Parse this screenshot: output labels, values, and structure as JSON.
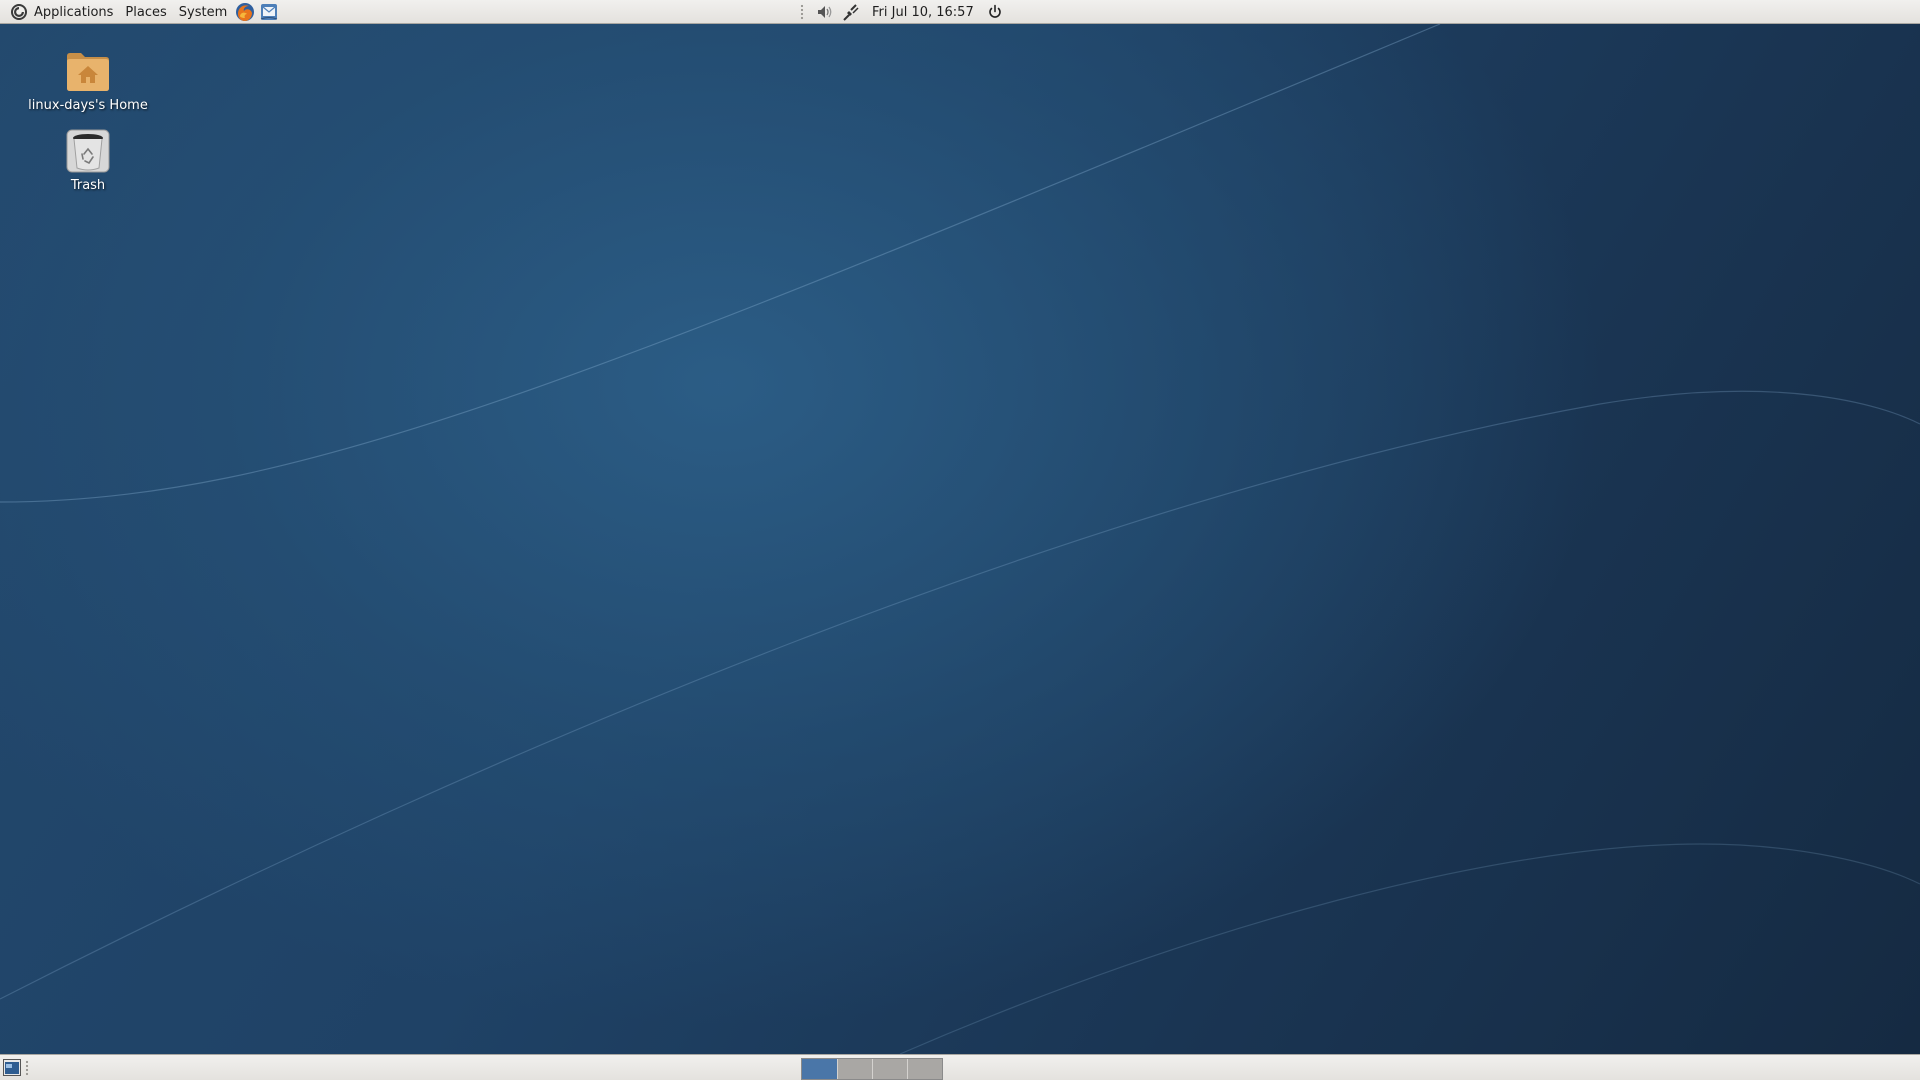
{
  "top_panel": {
    "menus": [
      {
        "label": "Applications"
      },
      {
        "label": "Places"
      },
      {
        "label": "System"
      }
    ],
    "launchers": [
      "firefox-icon",
      "mail-client-icon"
    ],
    "tray": [
      "volume-icon",
      "network-icon"
    ],
    "clock": "Fri Jul 10, 16:57",
    "power_icon": "power-icon"
  },
  "desktop": {
    "icons": [
      {
        "label": "linux-days's Home",
        "icon": "home-folder-icon"
      },
      {
        "label": "Trash",
        "icon": "trash-icon"
      }
    ]
  },
  "bottom_panel": {
    "workspaces": {
      "count": 4,
      "active_index": 0
    },
    "show_desktop_icon": "show-desktop-icon"
  },
  "colors": {
    "panel_bg": "#ecebe8",
    "desktop_bg": "#1f3c5c",
    "workspace_active": "#4a76a8",
    "workspace_inactive": "#a9a7a4"
  }
}
